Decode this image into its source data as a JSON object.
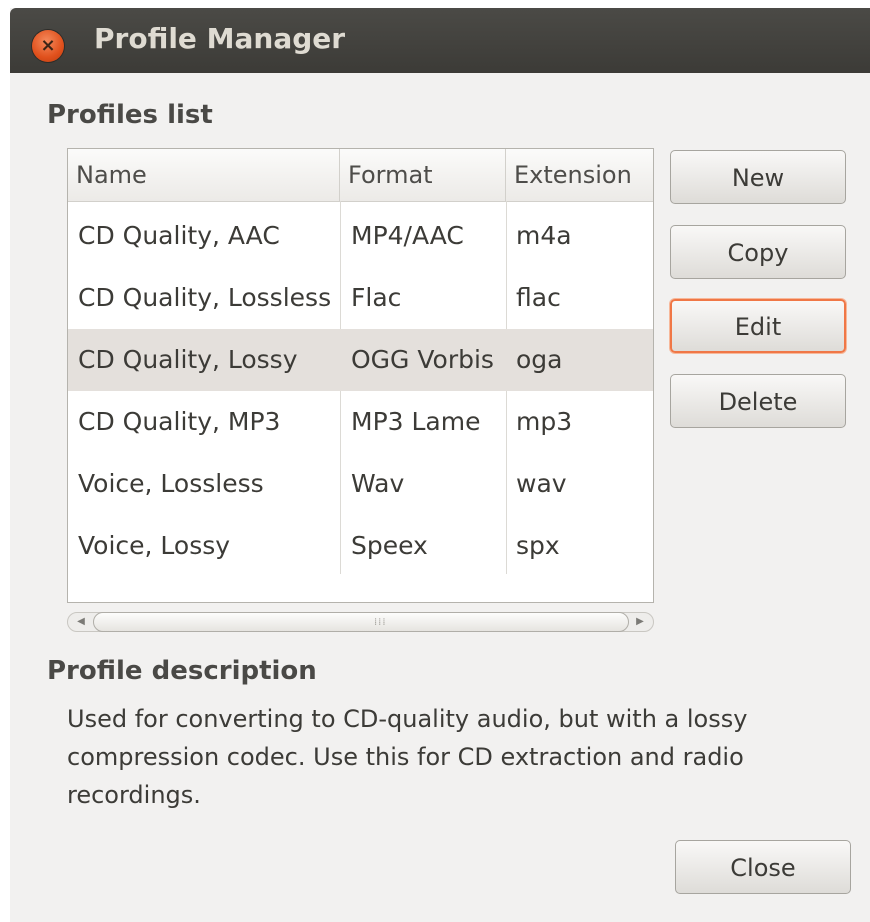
{
  "window": {
    "title": "Profile Manager"
  },
  "profiles_section": {
    "title": "Profiles list",
    "columns": [
      "Name",
      "Format",
      "Extension"
    ],
    "rows": [
      {
        "name": "CD Quality, AAC",
        "format": "MP4/AAC",
        "extension": "m4a"
      },
      {
        "name": "CD Quality, Lossless",
        "format": "Flac",
        "extension": "flac"
      },
      {
        "name": "CD Quality, Lossy",
        "format": "OGG Vorbis",
        "extension": "oga"
      },
      {
        "name": "CD Quality, MP3",
        "format": "MP3 Lame",
        "extension": "mp3"
      },
      {
        "name": "Voice, Lossless",
        "format": "Wav",
        "extension": "wav"
      },
      {
        "name": "Voice, Lossy",
        "format": "Speex",
        "extension": "spx"
      }
    ],
    "selected_index": 2
  },
  "buttons": {
    "new": "New",
    "copy": "Copy",
    "edit": "Edit",
    "delete": "Delete",
    "close": "Close"
  },
  "description_section": {
    "title": "Profile description",
    "text": "Used for converting to CD-quality audio, but with a lossy compression codec. Use this for CD extraction and radio recordings."
  },
  "colors": {
    "titlebar": "#3c3b37",
    "close_button": "#e0501c",
    "focus_ring": "#f07746",
    "selected_row": "#e4e0dc"
  },
  "icons": {
    "close": "close-icon"
  }
}
